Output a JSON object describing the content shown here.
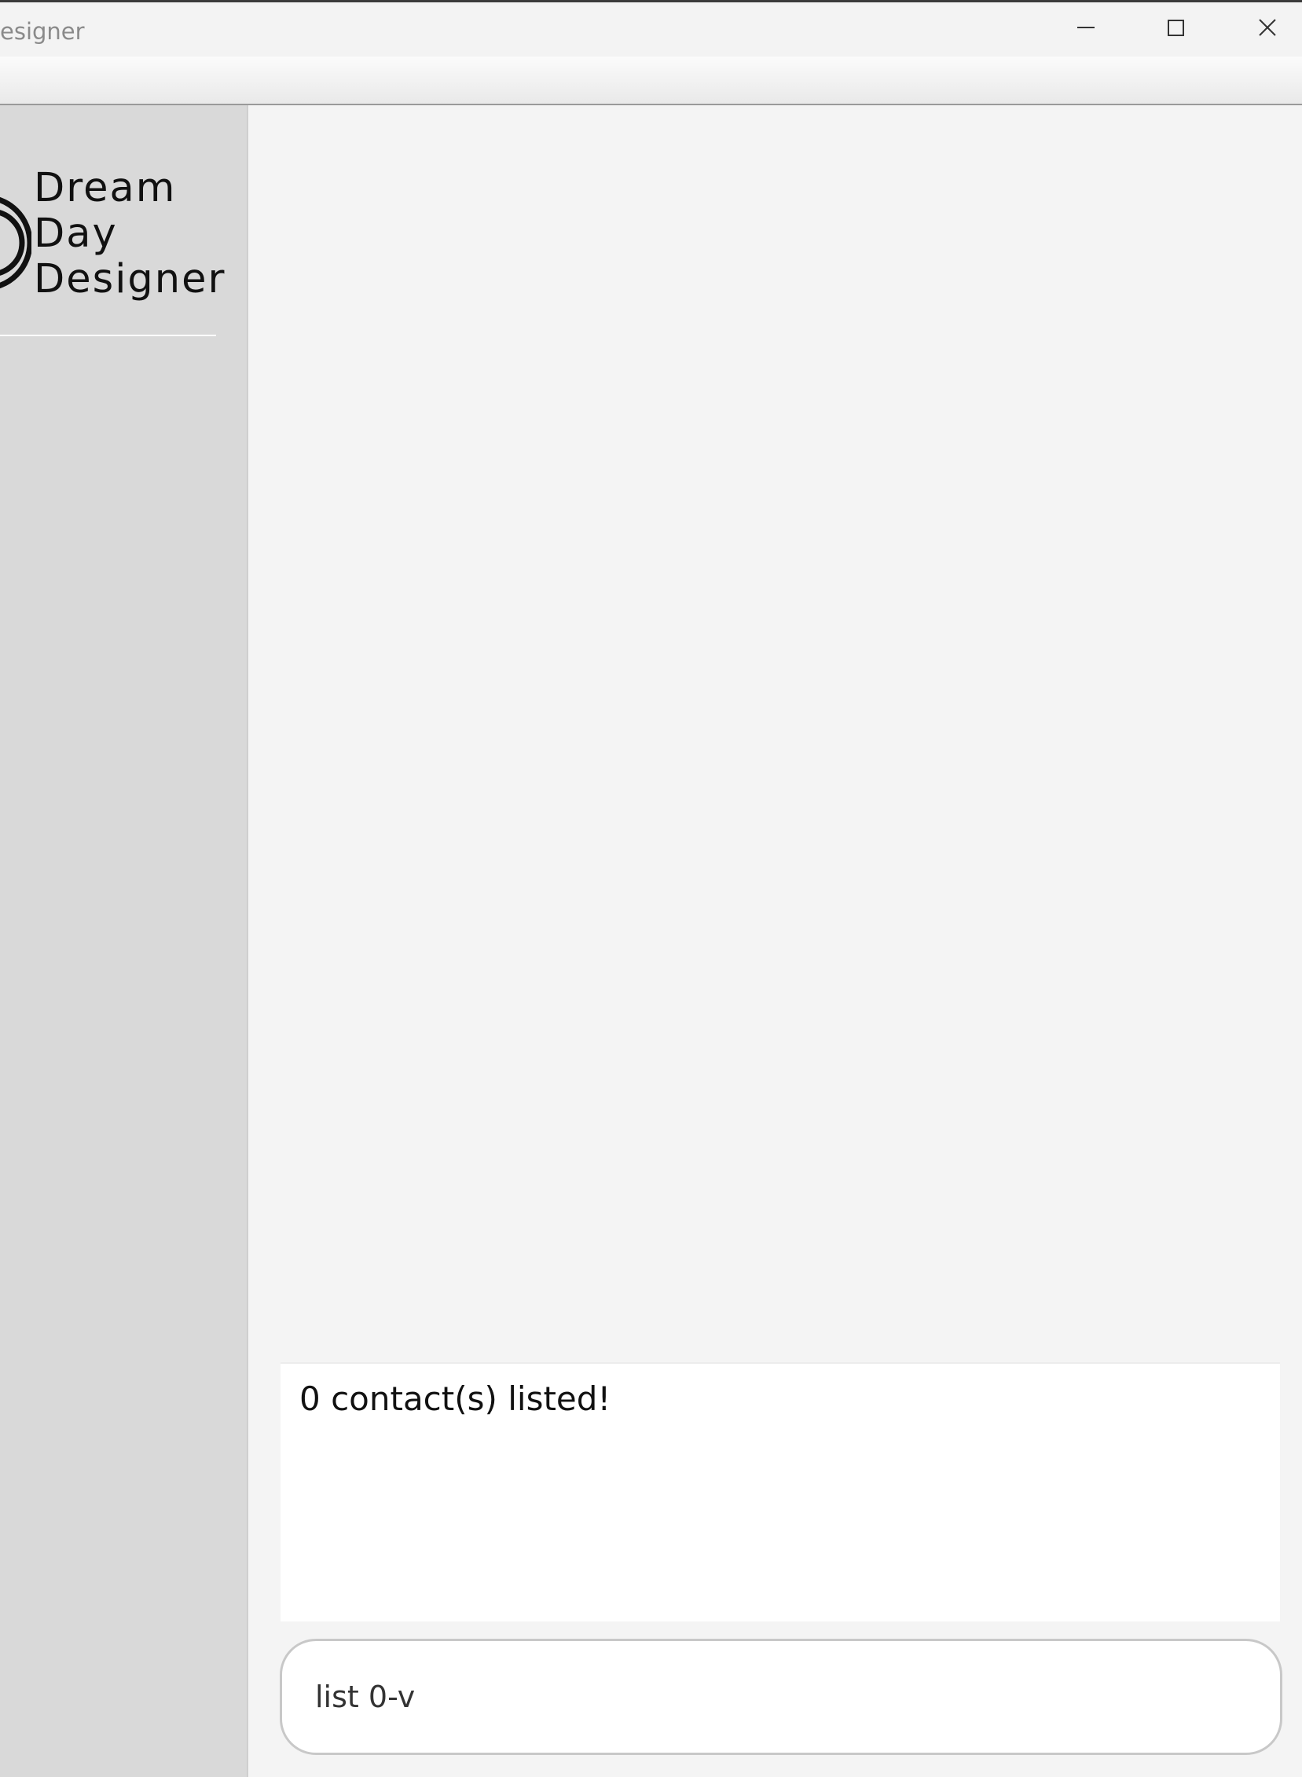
{
  "window": {
    "title": "esigner",
    "controls": {
      "minimize_icon": "minimize-icon",
      "maximize_icon": "maximize-icon",
      "close_icon": "close-icon"
    }
  },
  "sidebar": {
    "logo_lines": [
      "Dream",
      "Day",
      "Designer"
    ],
    "logo_icon": "concentric-arcs-logo-icon"
  },
  "main": {
    "result_text": "0 contact(s) listed!",
    "command_value": "list 0-v"
  },
  "colors": {
    "sidebar_bg": "#d9d9d9",
    "main_bg": "#f4f4f4",
    "panel_bg": "#ffffff"
  }
}
